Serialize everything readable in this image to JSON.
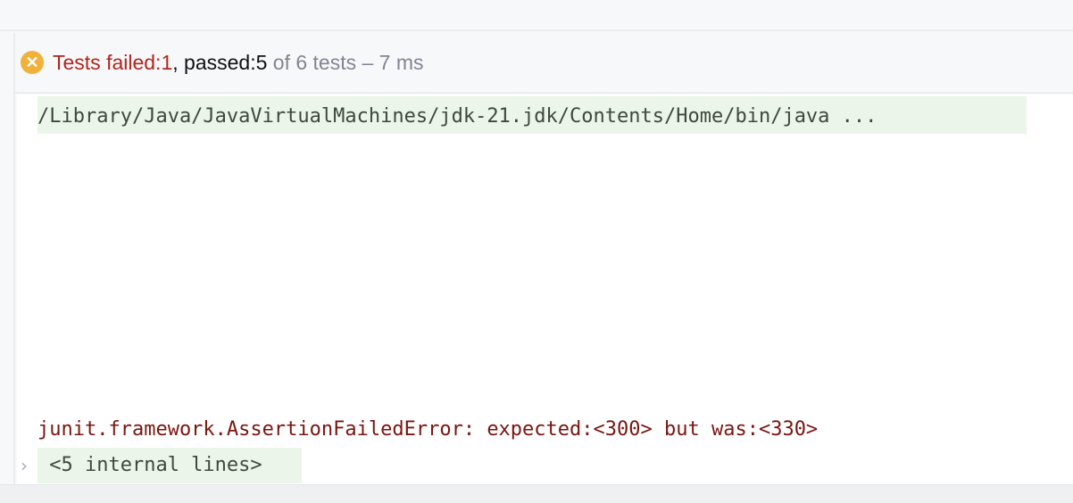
{
  "status": {
    "failed_label": "Tests failed: ",
    "failed_count": "1",
    "passed_label": ", passed: ",
    "passed_count": "5",
    "total": " of 6 tests – 7 ms",
    "icon": "error-circle-icon"
  },
  "console": {
    "command": "/Library/Java/JavaVirtualMachines/jdk-21.jdk/Contents/Home/bin/java ...",
    "error": "junit.framework.AssertionFailedError: expected:<300> but was:<330>",
    "folded": " <5 internal lines>"
  },
  "colors": {
    "failed": "#b0261c",
    "error_text": "#7a1510",
    "highlight": "#ebf5e9",
    "warning_icon": "#f2b13b"
  }
}
